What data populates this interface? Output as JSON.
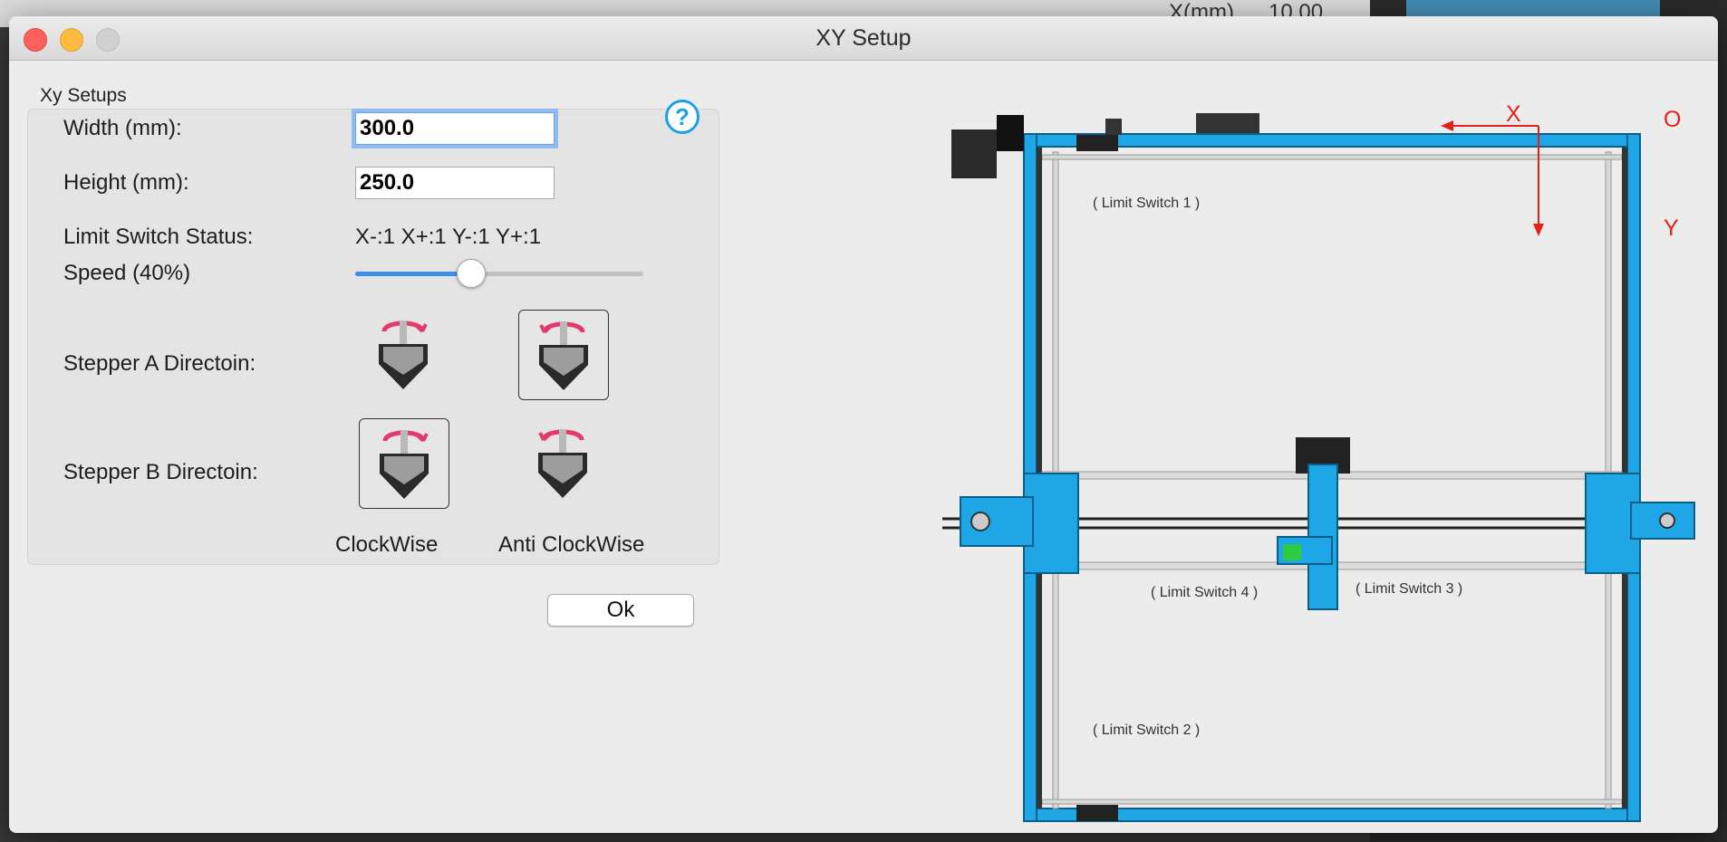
{
  "background": {
    "x_label": "X(mm)",
    "x_value": "10.00"
  },
  "window": {
    "title": "XY Setup"
  },
  "setup": {
    "group_label": "Xy Setups",
    "help_icon": "?",
    "width_label": "Width (mm):",
    "width_value": "300.0",
    "height_label": "Height (mm):",
    "height_value": "250.0",
    "limit_label": "Limit Switch Status:",
    "limit_value": "X-:1 X+:1 Y-:1 Y+:1",
    "speed_label": "Speed (40%)",
    "speed_fraction": 0.4,
    "stepper_a_label": "Stepper A Directoin:",
    "stepper_b_label": "Stepper B Directoin:",
    "stepper_a_selected": "anticlockwise",
    "stepper_b_selected": "clockwise",
    "clockwise_label": "ClockWise",
    "anticlockwise_label": "Anti ClockWise",
    "ok_label": "Ok"
  },
  "diagram": {
    "x_axis": "X",
    "y_axis": "Y",
    "origin": "O",
    "limit_switch_1": "( Limit Switch 1 )",
    "limit_switch_2": "( Limit Switch 2 )",
    "limit_switch_3": "( Limit Switch 3 )",
    "limit_switch_4": "( Limit Switch 4 )",
    "frame_color": "#1ea6e6",
    "axis_color": "#e4201a"
  },
  "colors": {
    "accent": "#3c8fe9",
    "help": "#1e9ee6",
    "close": "#fc605c",
    "minimize": "#fdbc40"
  }
}
